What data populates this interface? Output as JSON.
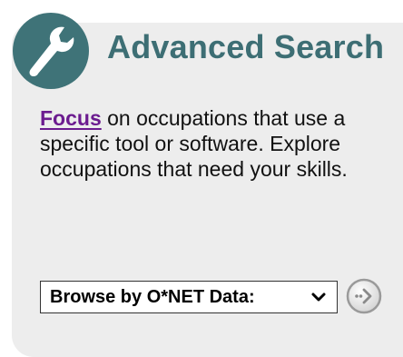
{
  "header": {
    "title": "Advanced Search",
    "icon": "wrench-icon"
  },
  "description": {
    "link_text": "Focus",
    "text": " on occupations that use a specific tool or software. Explore occupations that need your skills."
  },
  "browse": {
    "selected": "Browse by O*NET Data:",
    "go_icon": "go-arrow-icon"
  },
  "colors": {
    "accent": "#3d6e74",
    "link": "#6b1b8f",
    "panel": "#ededed"
  }
}
